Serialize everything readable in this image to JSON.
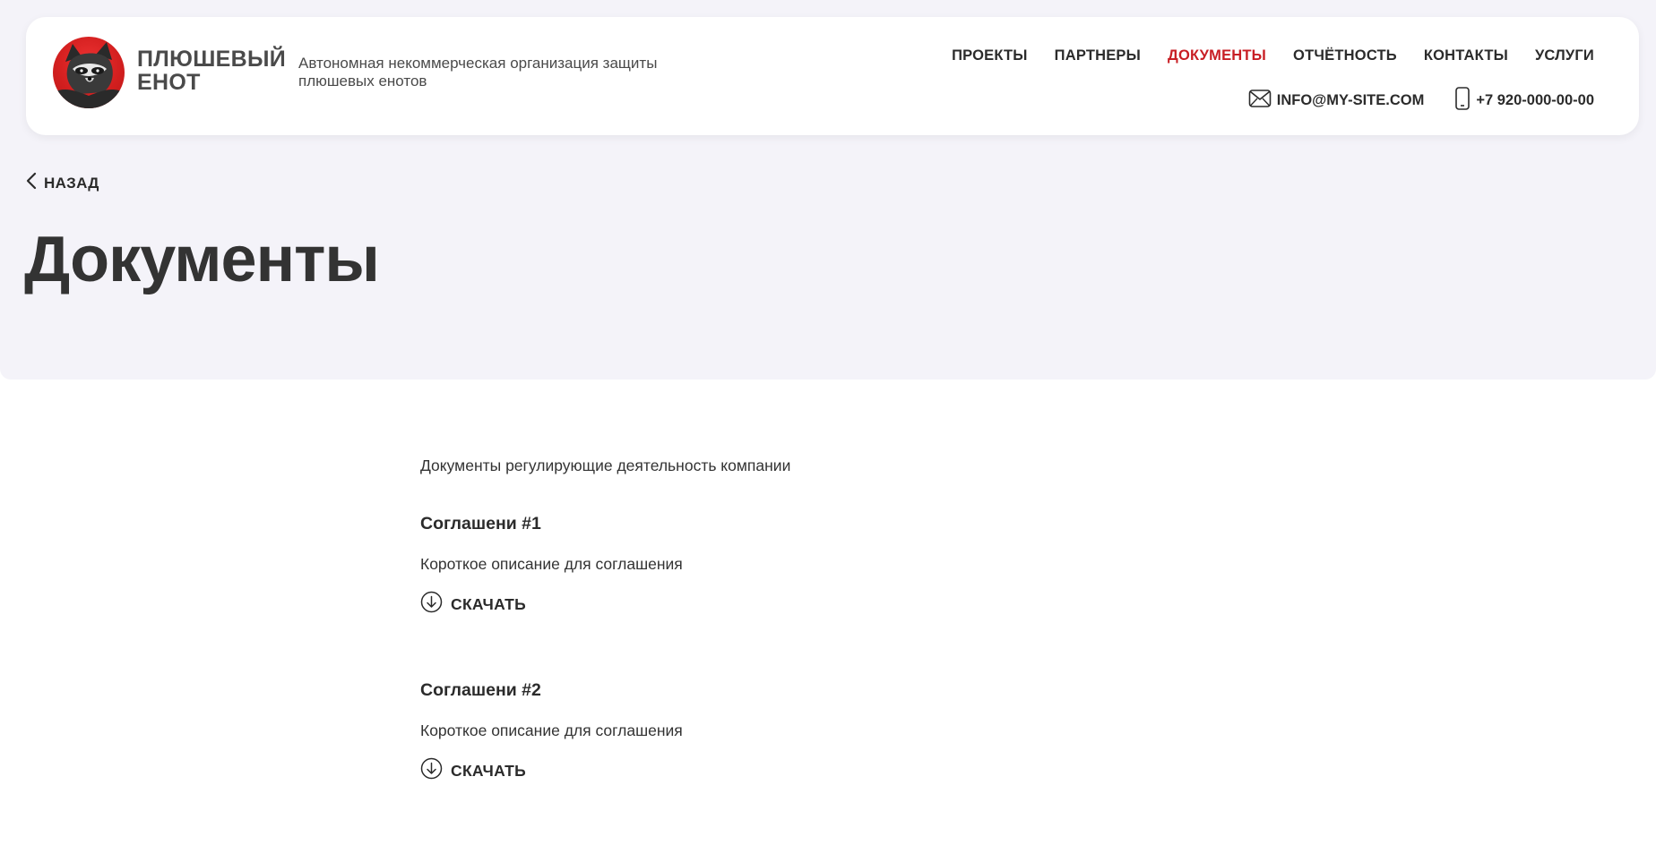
{
  "brand": {
    "name": "ПЛЮШЕВЫЙ\nЕНОТ",
    "description": "Автономная некоммерческая организация защиты плюшевых енотов",
    "logo_icon": "raccoon-logo-icon"
  },
  "nav": {
    "items": [
      {
        "label": "ПРОЕКТЫ",
        "active": false
      },
      {
        "label": "ПАРТНЕРЫ",
        "active": false
      },
      {
        "label": "ДОКУМЕНТЫ",
        "active": true
      },
      {
        "label": "ОТЧЁТНОСТЬ",
        "active": false
      },
      {
        "label": "КОНТАКТЫ",
        "active": false
      },
      {
        "label": "УСЛУГИ",
        "active": false
      }
    ]
  },
  "contacts": {
    "email": "INFO@MY-SITE.COM",
    "phone": "+7 920-000-00-00",
    "email_icon": "mail-icon",
    "phone_icon": "phone-icon"
  },
  "back": {
    "label": "НАЗАД",
    "icon": "chevron-left-icon"
  },
  "page": {
    "title": "Документы",
    "intro": "Документы регулирующие деятельность компании"
  },
  "documents": [
    {
      "title": "Соглашени #1",
      "description": "Короткое описание для соглашения",
      "download_label": "СКАЧАТЬ"
    },
    {
      "title": "Соглашени #2",
      "description": "Короткое описание для соглашения",
      "download_label": "СКАЧАТЬ"
    }
  ],
  "colors": {
    "accent": "#c81e24",
    "background": "#f4f3f9",
    "text": "#2b2b2b"
  }
}
